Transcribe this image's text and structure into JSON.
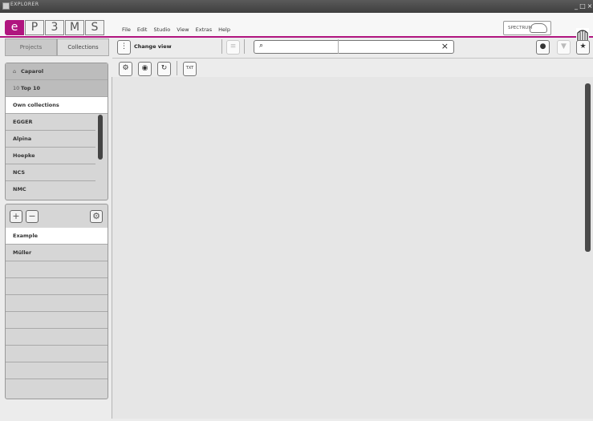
{
  "window": {
    "title": "EXPLORER"
  },
  "app": {
    "logo_letters": [
      "e",
      "P",
      "3",
      "M",
      "S"
    ]
  },
  "menu": [
    "File",
    "Edit",
    "Studio",
    "View",
    "Extras",
    "Help"
  ],
  "spectrum_label": "SPECTRUM",
  "left_tabs": [
    "Projects",
    "Collections"
  ],
  "collections": {
    "top": [
      {
        "icon": "caparol-icon",
        "label": "Caparol"
      },
      {
        "icon": "top10-icon",
        "prefix": "10",
        "label": "Top 10"
      }
    ],
    "own_label": "Own collections",
    "own_items": [
      "EGGER",
      "Alpina",
      "Hoepke",
      "NCS",
      "NMC"
    ]
  },
  "projects": {
    "items": [
      "Example",
      "Müller"
    ]
  },
  "toolbar": {
    "change_view_label": "Change view",
    "search": {
      "value": "",
      "placeholder": ""
    }
  },
  "colors": {
    "accent": "#b0157f"
  }
}
